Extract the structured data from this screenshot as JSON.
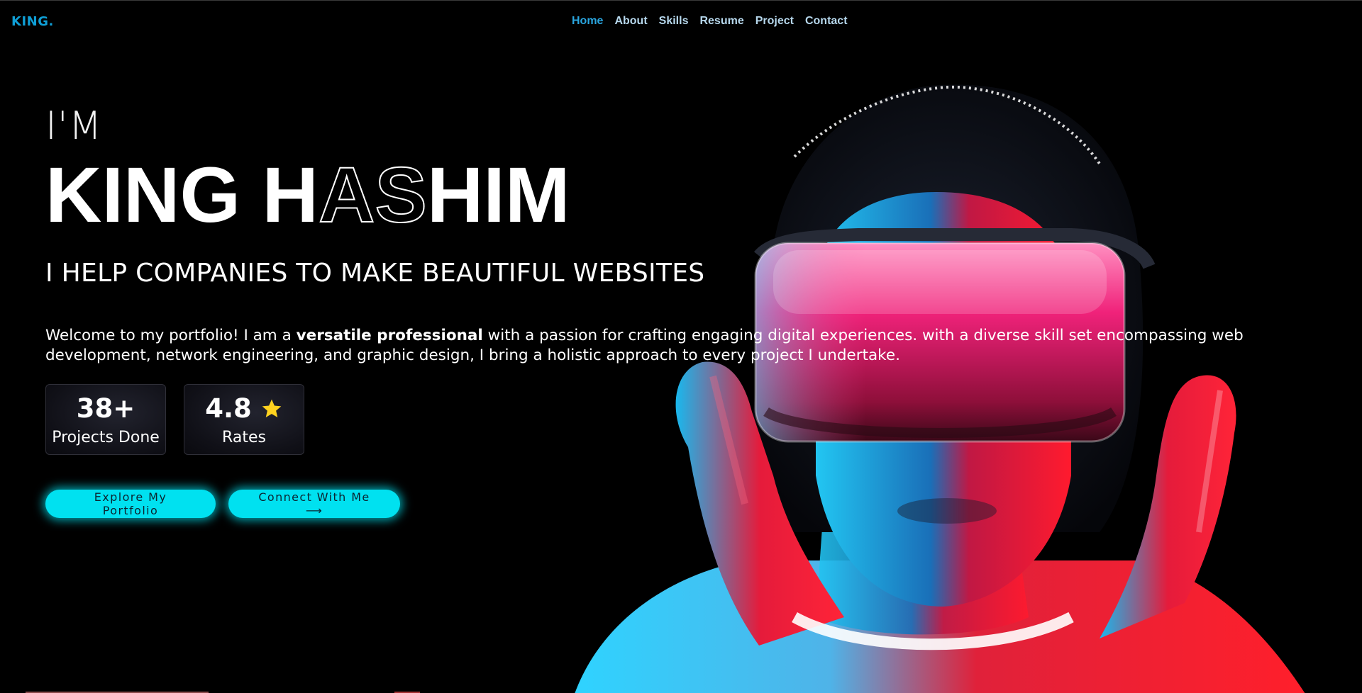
{
  "header": {
    "logo": "KING.",
    "nav": [
      "Home",
      "About",
      "Skills",
      "Resume",
      "Project",
      "Contact"
    ]
  },
  "hero": {
    "intro_prefix": "I'M",
    "name_part1": "KING H",
    "name_part2": "AS",
    "name_part3": "HIM",
    "tagline": "I HELP COMPANIES TO MAKE BEAUTIFUL WEBSITES",
    "intro_before": "Welcome to my portfolio! I am a ",
    "intro_bold": "versatile professional",
    "intro_after": " with a passion for crafting engaging digital experiences. with a diverse skill set encompassing web development, network engineering, and graphic design, I bring a holistic approach to every project I undertake."
  },
  "stats": [
    {
      "value": "38+",
      "label": "Projects Done"
    },
    {
      "value": "4.8",
      "label": "Rates",
      "icon": "star-icon"
    }
  ],
  "buttons": {
    "primary": "Explore My Portfolio",
    "secondary": "Connect With Me ⟶"
  },
  "colors": {
    "accent": "#00e1f0",
    "logo": "#0f9fd6",
    "nav_active": "#2aa6e0",
    "star": "#ffd21f"
  }
}
